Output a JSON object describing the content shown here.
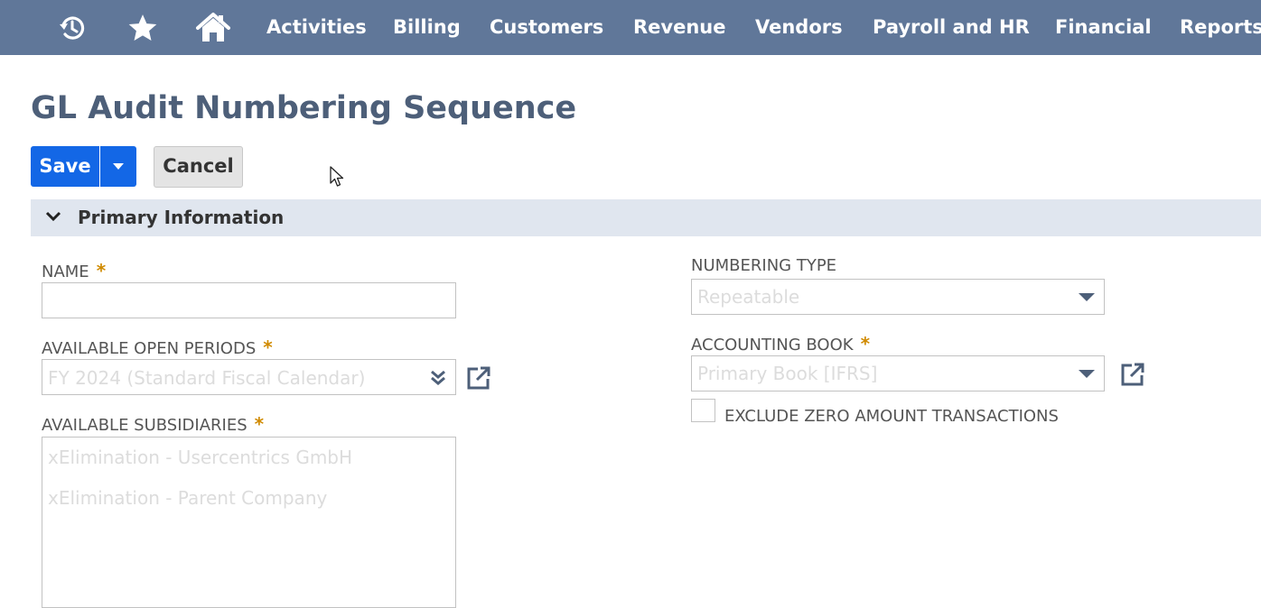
{
  "nav": {
    "icons": [
      "recent-history-icon",
      "star-icon",
      "home-icon"
    ],
    "items": [
      "Activities",
      "Billing",
      "Customers",
      "Revenue",
      "Vendors",
      "Payroll and HR",
      "Financial",
      "Reports"
    ]
  },
  "page": {
    "title": "GL Audit Numbering Sequence"
  },
  "toolbar": {
    "save_label": "Save",
    "cancel_label": "Cancel"
  },
  "section": {
    "title": "Primary Information"
  },
  "form": {
    "required_mark": "*",
    "name": {
      "label": "NAME",
      "value": ""
    },
    "periods": {
      "label": "AVAILABLE OPEN PERIODS",
      "value": "FY 2024 (Standard Fiscal Calendar)"
    },
    "subsidiaries": {
      "label": "AVAILABLE SUBSIDIARIES",
      "items": [
        "xElimination - Usercentrics GmbH",
        "xElimination - Parent Company"
      ]
    },
    "numbering_type": {
      "label": "NUMBERING TYPE",
      "value": "Repeatable"
    },
    "accounting_book": {
      "label": "ACCOUNTING BOOK",
      "value": "Primary Book [IFRS]"
    },
    "exclude_zero": {
      "label": "EXCLUDE ZERO AMOUNT TRANSACTIONS",
      "checked": false
    }
  },
  "colors": {
    "nav_bg": "#607799",
    "title": "#4d5f79",
    "primary_button": "#1367e6",
    "section_bg": "#e0e6ef",
    "required": "#d08a00"
  }
}
